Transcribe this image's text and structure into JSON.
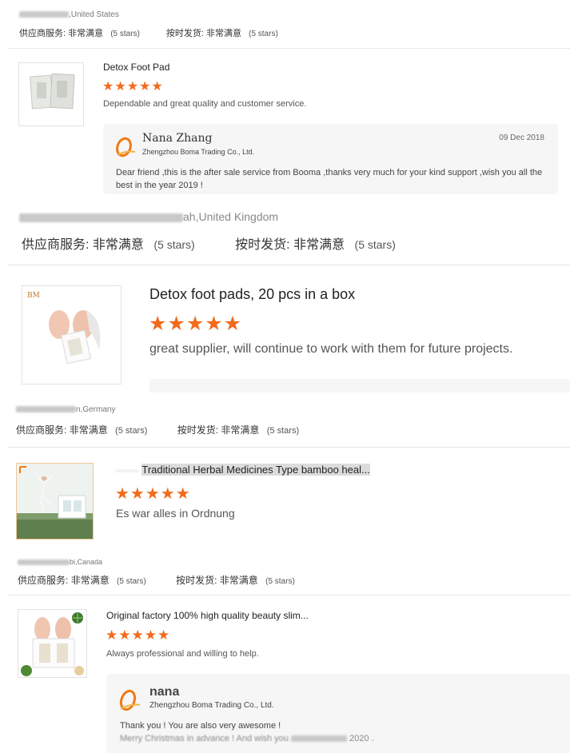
{
  "reviews": [
    {
      "location": ",United States",
      "supplier_label": "供应商服务:",
      "supplier_value": "非常满意",
      "supplier_stars": "(5 stars)",
      "delivery_label": "按时发货:",
      "delivery_value": "非常满意",
      "delivery_stars": "(5 stars)"
    },
    {
      "product_title": "Detox Foot Pad",
      "stars": "★★★★★",
      "review_text": "Dependable and great quality and customer service.",
      "reply": {
        "name": "Nana Zhang",
        "company": "Zhengzhou Boma Trading Co., Ltd.",
        "date": "09 Dec 2018",
        "text": "Dear friend ,this is the after sale service from Booma ,thanks very much for your kind support ,wish you all the best in the year 2019 !"
      },
      "location": "ah,United Kingdom",
      "supplier_label": "供应商服务:",
      "supplier_value": "非常满意",
      "supplier_stars": "(5 stars)",
      "delivery_label": "按时发货:",
      "delivery_value": "非常满意",
      "delivery_stars": "(5 stars)"
    },
    {
      "product_title": "Detox foot pads, 20 pcs in a box",
      "image_badge": "BM",
      "stars": "★★★★★",
      "review_text": "great supplier, will continue to work with them for future projects.",
      "location": "n,Germany",
      "supplier_label": "供应商服务:",
      "supplier_value": "非常满意",
      "supplier_stars": "(5 stars)",
      "delivery_label": "按时发货:",
      "delivery_value": "非常满意",
      "delivery_stars": "(5 stars)"
    },
    {
      "product_title": "Traditional Herbal Medicines Type bamboo heal...",
      "stars": "★★★★★",
      "review_text": "Es war alles in Ordnung",
      "location": "bi,Canada",
      "supplier_label": "供应商服务:",
      "supplier_value": "非常满意",
      "supplier_stars": "(5 stars)",
      "delivery_label": "按时发货:",
      "delivery_value": "非常满意",
      "delivery_stars": "(5 stars)"
    },
    {
      "product_title": "Original factory 100% high quality beauty slim...",
      "stars": "★★★★★",
      "review_text": "Always professional and willing to help.",
      "reply": {
        "name": "nana",
        "company": "Zhengzhou Boma Trading Co., Ltd.",
        "text_line1": "Thank you !  You are also very  awesome !",
        "text_line2": "Merry Christmas in advance ! And wish you",
        "text_line2_end": "2020 ."
      }
    }
  ],
  "colors": {
    "star": "#f26b1d",
    "reply_bg": "#f6f6f7",
    "divider": "#e6e6e6",
    "brand_logo": "#f07a12"
  },
  "icons": {
    "star": "star-icon",
    "company_logo": "booma-logo-icon"
  }
}
